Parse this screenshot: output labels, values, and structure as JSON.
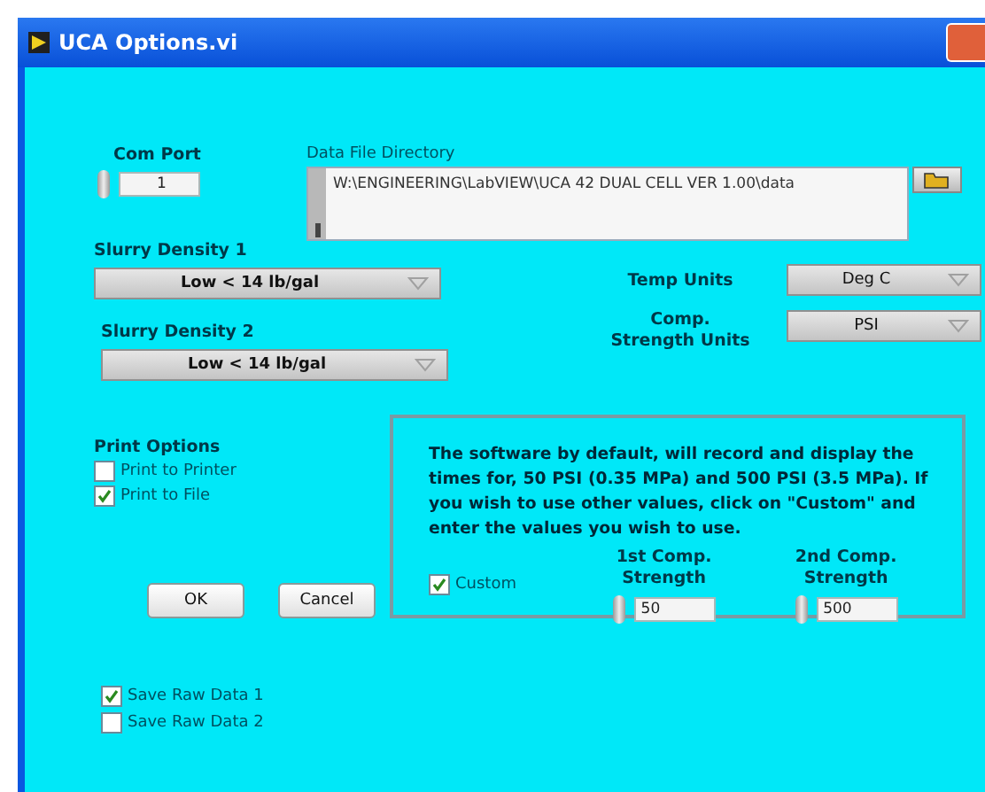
{
  "window": {
    "title": "UCA Options.vi"
  },
  "com_port": {
    "label": "Com Port",
    "value": "1"
  },
  "data_file_directory": {
    "label": "Data File Directory",
    "value": "W:\\ENGINEERING\\LabVIEW\\UCA 42 DUAL CELL VER 1.00\\data"
  },
  "slurry_density": [
    {
      "label": "Slurry Density 1",
      "value": "Low < 14 lb/gal"
    },
    {
      "label": "Slurry Density 2",
      "value": "Low < 14 lb/gal"
    }
  ],
  "temp_units": {
    "label": "Temp Units",
    "value": "Deg C"
  },
  "comp_strength_units": {
    "label": "Comp. Strength Units",
    "value": "PSI"
  },
  "print_options": {
    "label": "Print Options",
    "items": [
      {
        "label": "Print to Printer",
        "checked": false
      },
      {
        "label": "Print to File",
        "checked": true
      }
    ]
  },
  "custom_box": {
    "text": "The software by default, will record and display the times for, 50 PSI (0.35 MPa) and 500 PSI (3.5 MPa). If you wish to use other values, click on \"Custom\" and enter the values you wish to use.",
    "custom": {
      "label": "Custom",
      "checked": true
    },
    "strengths": [
      {
        "label": "1st Comp. Strength",
        "value": "50"
      },
      {
        "label": "2nd Comp. Strength",
        "value": "500"
      }
    ]
  },
  "buttons": [
    "OK",
    "Cancel"
  ],
  "save_raw_data": [
    {
      "label": "Save Raw Data 1",
      "checked": true
    },
    {
      "label": "Save Raw Data 2",
      "checked": false
    }
  ]
}
